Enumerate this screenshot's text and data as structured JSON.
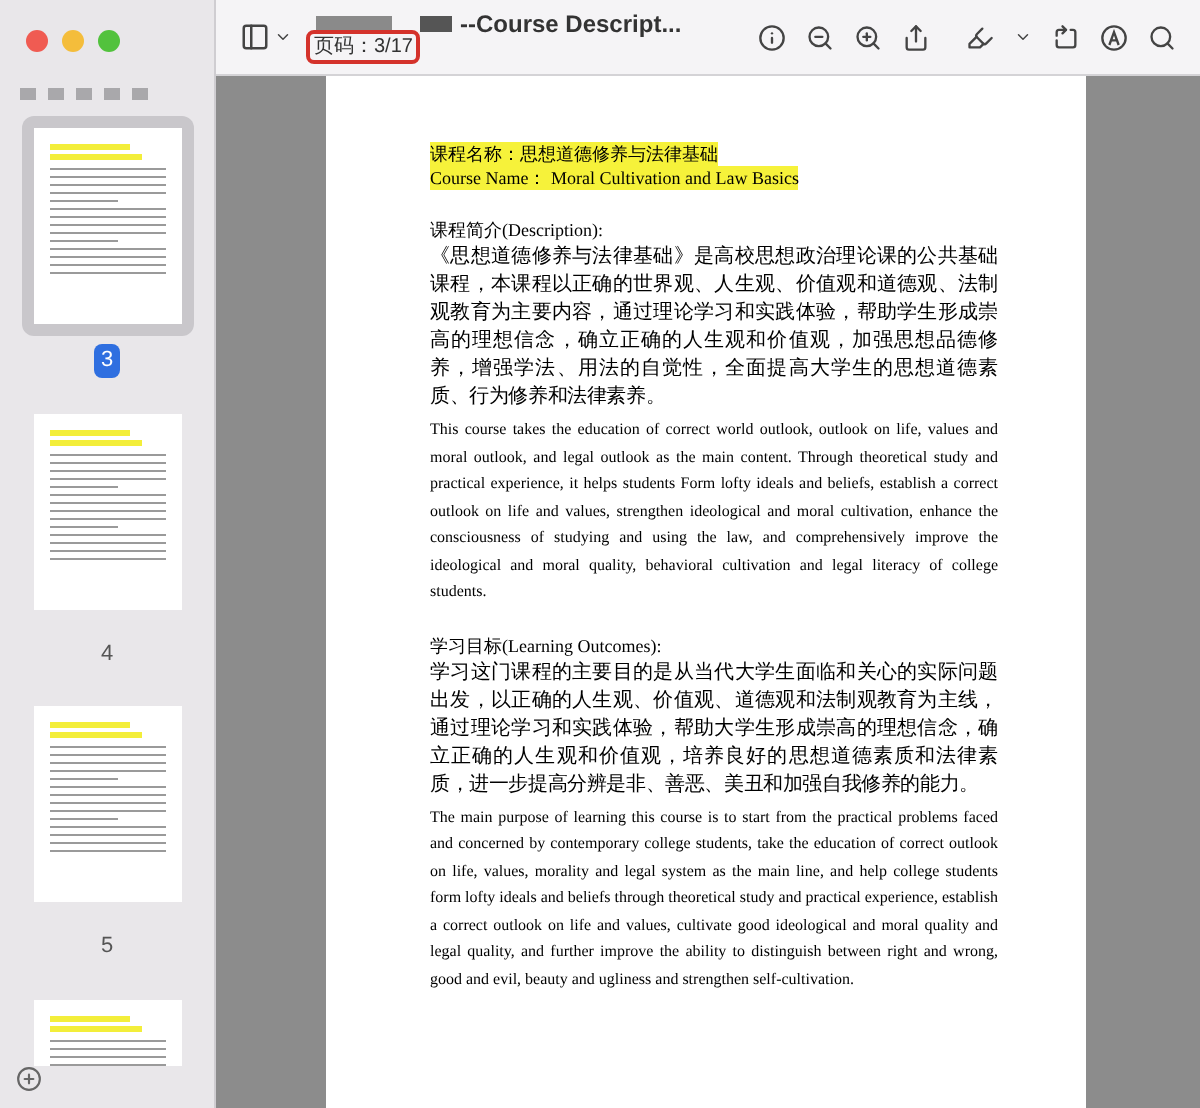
{
  "window": {
    "title": "--Course Descript..."
  },
  "page_indicator": {
    "label": "页码：3/17"
  },
  "thumbnails": [
    {
      "label": "3",
      "selected": true
    },
    {
      "label": "4",
      "selected": false
    },
    {
      "label": "5",
      "selected": false
    },
    {
      "selected": false
    }
  ],
  "document": {
    "highlighted": [
      "课程名称：思想道德修养与法律基础",
      "Course Name： Moral Cultivation and Law Basics"
    ],
    "sections": [
      {
        "heading": "课程简介(Description):",
        "paragraphs": [
          {
            "kind": "zh",
            "text": "《思想道德修养与法律基础》是高校思想政治理论课的公共基础课程，本课程以正确的世界观、人生观、价值观和道德观、法制观教育为主要内容，通过理论学习和实践体验，帮助学生形成崇高的理想信念，确立正确的人生观和价值观，加强思想品德修养，增强学法、用法的自觉性，全面提高大学生的思想道德素质、行为修养和法律素养。"
          },
          {
            "kind": "en",
            "text": "This course takes the education of correct world outlook, outlook on life, values and moral outlook, and legal outlook as the main content. Through theoretical study and practical experience, it helps students Form lofty ideals and beliefs, establish a correct outlook on life and values, strengthen ideological and moral cultivation, enhance the consciousness of studying and using the law, and comprehensively improve the ideological and moral quality, behavioral cultivation and legal literacy of college students."
          }
        ]
      },
      {
        "heading": "学习目标(Learning Outcomes):",
        "paragraphs": [
          {
            "kind": "zh",
            "text": "学习这门课程的主要目的是从当代大学生面临和关心的实际问题出发，以正确的人生观、价值观、道德观和法制观教育为主线，通过理论学习和实践体验，帮助大学生形成崇高的理想信念，确立正确的人生观和价值观，培养良好的思想道德素质和法律素质，进一步提高分辨是非、善恶、美丑和加强自我修养的能力。"
          },
          {
            "kind": "en",
            "text": "The main purpose of learning this course is to start from the practical problems faced and concerned by contemporary college students, take the education of correct outlook on life, values, morality and legal system as the main line, and help college students form lofty ideals and beliefs through theoretical study and practical experience, establish a correct outlook on life and values, cultivate good ideological and moral quality and legal quality, and further improve the ability to distinguish between right and wrong, good and evil, beauty and ugliness and strengthen self-cultivation."
          }
        ]
      }
    ]
  }
}
